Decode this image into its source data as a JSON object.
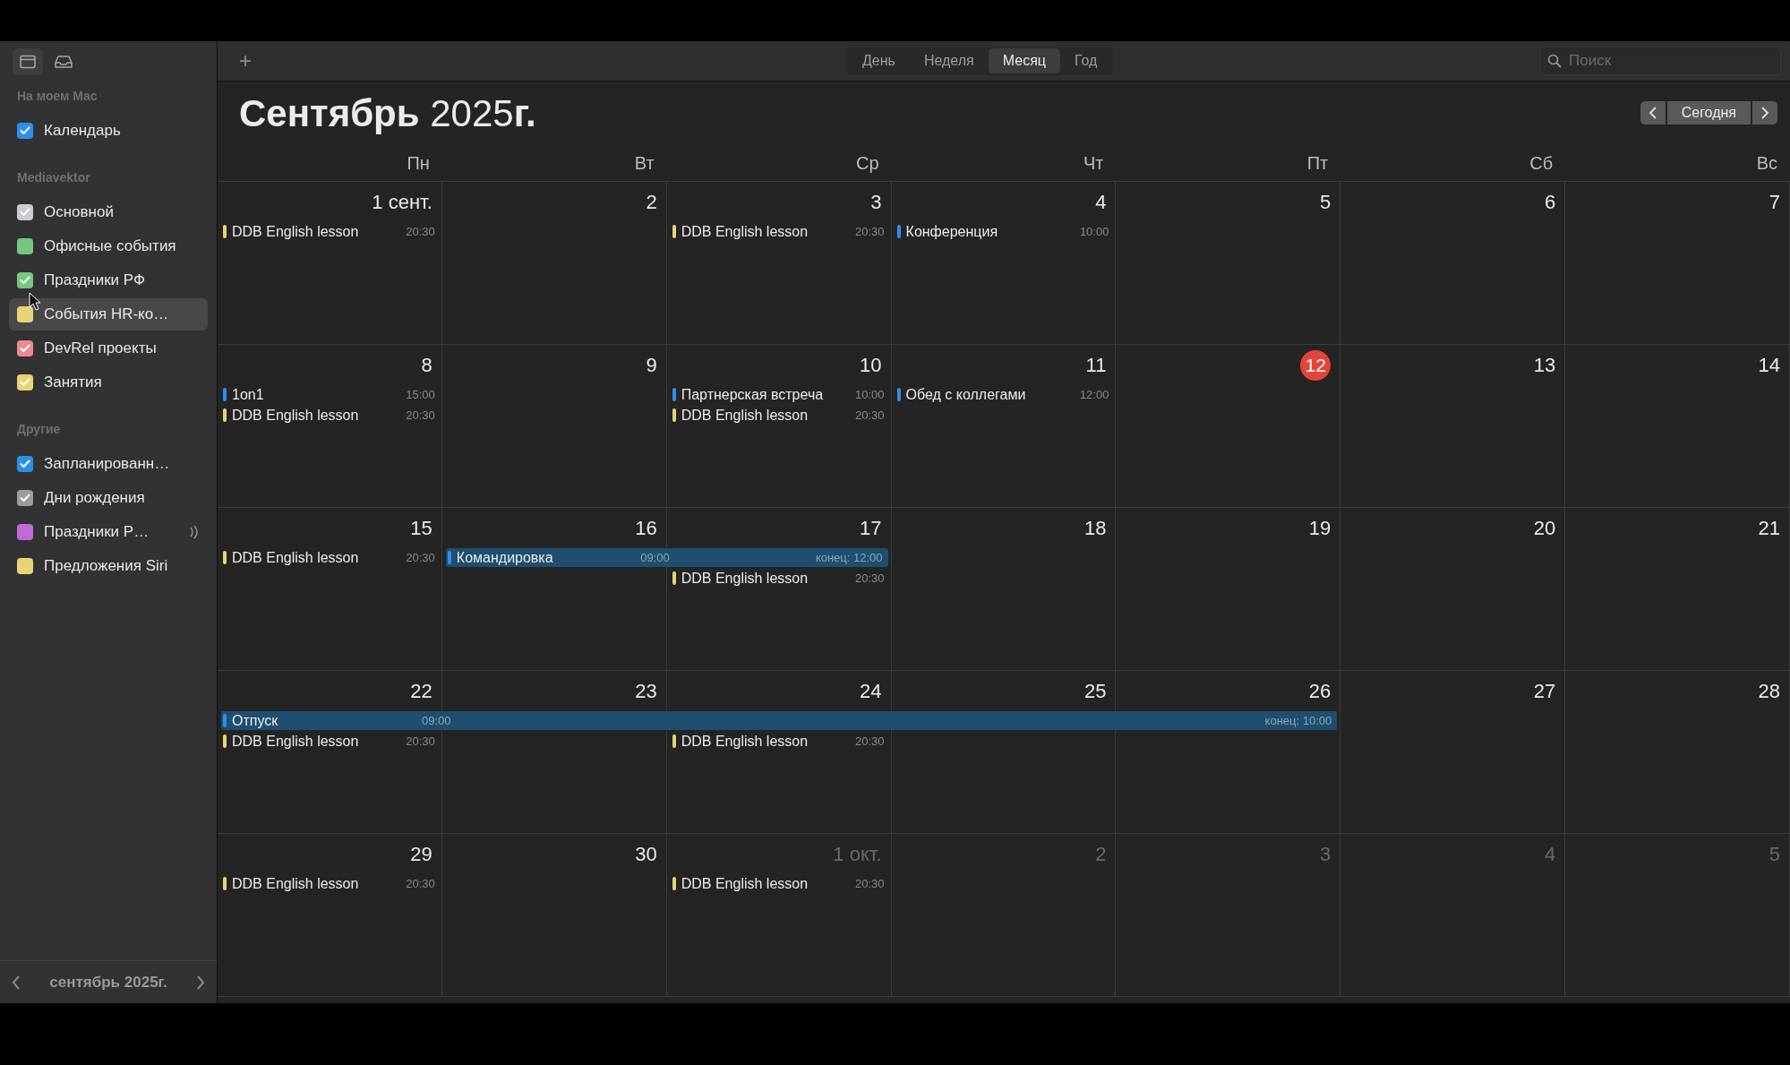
{
  "toolbar": {
    "add_button": "+",
    "view_tabs": [
      {
        "label": "День",
        "selected": false
      },
      {
        "label": "Неделя",
        "selected": false
      },
      {
        "label": "Месяц",
        "selected": true
      },
      {
        "label": "Год",
        "selected": false
      }
    ],
    "search": {
      "placeholder": "Поиск"
    }
  },
  "sidebar": {
    "groups": [
      {
        "title": "На моем Mac",
        "items": [
          {
            "label": "Календарь",
            "color": "#2f8fe8",
            "checked": true,
            "selected": false
          }
        ]
      },
      {
        "title": "Mediavektor",
        "items": [
          {
            "label": "Основной",
            "color": "#c9ccd1",
            "checked": true,
            "selected": false
          },
          {
            "label": "Офисные события",
            "color": "#74c77f",
            "checked": false,
            "selected": false
          },
          {
            "label": "Праздники РФ",
            "color": "#74c77f",
            "checked": true,
            "selected": false
          },
          {
            "label": "События HR-ко…",
            "color": "#e8d477",
            "checked": false,
            "selected": true
          },
          {
            "label": "DevRel проекты",
            "color": "#e98c92",
            "checked": true,
            "selected": false
          },
          {
            "label": "Занятия",
            "color": "#e8d477",
            "checked": true,
            "selected": false
          }
        ]
      },
      {
        "title": "Другие",
        "items": [
          {
            "label": "Запланированн…",
            "color": "#2f8fe8",
            "checked": true,
            "selected": false
          },
          {
            "label": "Дни рождения",
            "color": "#9b9b9b",
            "checked": true,
            "selected": false
          },
          {
            "label": "Праздники Р…",
            "color": "#c26ad8",
            "checked": false,
            "selected": false,
            "subscribed": true
          },
          {
            "label": "Предложения Siri",
            "color": "#e8d477",
            "checked": false,
            "selected": false
          }
        ]
      }
    ],
    "mini_month": {
      "label": "сентябрь 2025г."
    }
  },
  "header": {
    "month": "Сентябрь",
    "year": "2025",
    "suffix": "г.",
    "today_button": "Сегодня"
  },
  "weekdays": [
    "Пн",
    "Вт",
    "Ср",
    "Чт",
    "Пт",
    "Сб",
    "Вс"
  ],
  "weeks": [
    {
      "days": [
        {
          "label": "1 сент.",
          "in_month": true,
          "today": false,
          "events": [
            {
              "kind": "single",
              "title": "DDB English lesson",
              "time": "20:30",
              "color": "#e8d477"
            }
          ]
        },
        {
          "label": "2",
          "in_month": true,
          "today": false
        },
        {
          "label": "3",
          "in_month": true,
          "today": false,
          "events": [
            {
              "kind": "single",
              "title": "DDB English lesson",
              "time": "20:30",
              "color": "#e8d477"
            }
          ]
        },
        {
          "label": "4",
          "in_month": true,
          "today": false,
          "events": [
            {
              "kind": "single",
              "title": "Конференция",
              "time": "10:00",
              "color": "#2f8fe8"
            }
          ]
        },
        {
          "label": "5",
          "in_month": true,
          "today": false
        },
        {
          "label": "6",
          "in_month": true,
          "today": false
        },
        {
          "label": "7",
          "in_month": true,
          "today": false
        }
      ]
    },
    {
      "days": [
        {
          "label": "8",
          "in_month": true,
          "today": false,
          "events": [
            {
              "kind": "single",
              "title": "1on1",
              "time": "15:00",
              "color": "#2f8fe8"
            },
            {
              "kind": "single",
              "title": "DDB English lesson",
              "time": "20:30",
              "color": "#e8d477"
            }
          ]
        },
        {
          "label": "9",
          "in_month": true,
          "today": false
        },
        {
          "label": "10",
          "in_month": true,
          "today": false,
          "events": [
            {
              "kind": "single",
              "title": "Партнерская встреча",
              "time": "10:00",
              "color": "#2f8fe8"
            },
            {
              "kind": "single",
              "title": "DDB English lesson",
              "time": "20:30",
              "color": "#e8d477"
            }
          ]
        },
        {
          "label": "11",
          "in_month": true,
          "today": false,
          "events": [
            {
              "kind": "single",
              "title": "Обед с коллегами",
              "time": "12:00",
              "color": "#2f8fe8"
            }
          ]
        },
        {
          "label": "12",
          "in_month": true,
          "today": true
        },
        {
          "label": "13",
          "in_month": true,
          "today": false
        },
        {
          "label": "14",
          "in_month": true,
          "today": false
        }
      ]
    },
    {
      "days": [
        {
          "label": "15",
          "in_month": true,
          "today": false,
          "events": [
            {
              "kind": "single",
              "title": "DDB English lesson",
              "time": "20:30",
              "color": "#e8d477"
            }
          ]
        },
        {
          "label": "16",
          "in_month": true,
          "today": false,
          "events": [
            {
              "kind": "multi_day",
              "title": "Командировка",
              "time": "09:00",
              "color": "#2f8fe8"
            }
          ]
        },
        {
          "label": "17",
          "in_month": true,
          "today": false,
          "events": [
            {
              "kind": "continuation",
              "end": "конец: 12:00"
            },
            {
              "kind": "single",
              "title": "DDB English lesson",
              "time": "20:30",
              "color": "#e8d477"
            }
          ]
        },
        {
          "label": "18",
          "in_month": true,
          "today": false
        },
        {
          "label": "19",
          "in_month": true,
          "today": false
        },
        {
          "label": "20",
          "in_month": true,
          "today": false
        },
        {
          "label": "21",
          "in_month": true,
          "today": false
        }
      ]
    },
    {
      "days": [
        {
          "label": "22",
          "in_month": true,
          "today": false,
          "events": [
            {
              "kind": "multi_day",
              "title": "Отпуск",
              "time": "09:00",
              "color": "#2f8fe8"
            },
            {
              "kind": "single",
              "title": "DDB English lesson",
              "time": "20:30",
              "color": "#e8d477"
            }
          ]
        },
        {
          "label": "23",
          "in_month": true,
          "today": false,
          "events": [
            {
              "kind": "continuation"
            }
          ]
        },
        {
          "label": "24",
          "in_month": true,
          "today": false,
          "events": [
            {
              "kind": "continuation"
            },
            {
              "kind": "single",
              "title": "DDB English lesson",
              "time": "20:30",
              "color": "#e8d477"
            }
          ]
        },
        {
          "label": "25",
          "in_month": true,
          "today": false,
          "events": [
            {
              "kind": "continuation"
            }
          ]
        },
        {
          "label": "26",
          "in_month": true,
          "today": false,
          "events": [
            {
              "kind": "continuation",
              "end": "конец: 10:00"
            }
          ]
        },
        {
          "label": "27",
          "in_month": true,
          "today": false
        },
        {
          "label": "28",
          "in_month": true,
          "today": false
        }
      ]
    },
    {
      "days": [
        {
          "label": "29",
          "in_month": true,
          "today": false,
          "events": [
            {
              "kind": "single",
              "title": "DDB English lesson",
              "time": "20:30",
              "color": "#e8d477"
            }
          ]
        },
        {
          "label": "30",
          "in_month": true,
          "today": false
        },
        {
          "label": "1 окт.",
          "in_month": false,
          "today": false,
          "events": [
            {
              "kind": "single",
              "title": "DDB English lesson",
              "time": "20:30",
              "color": "#e8d477"
            }
          ]
        },
        {
          "label": "2",
          "in_month": false,
          "today": false
        },
        {
          "label": "3",
          "in_month": false,
          "today": false
        },
        {
          "label": "4",
          "in_month": false,
          "today": false
        },
        {
          "label": "5",
          "in_month": false,
          "today": false
        }
      ]
    }
  ]
}
